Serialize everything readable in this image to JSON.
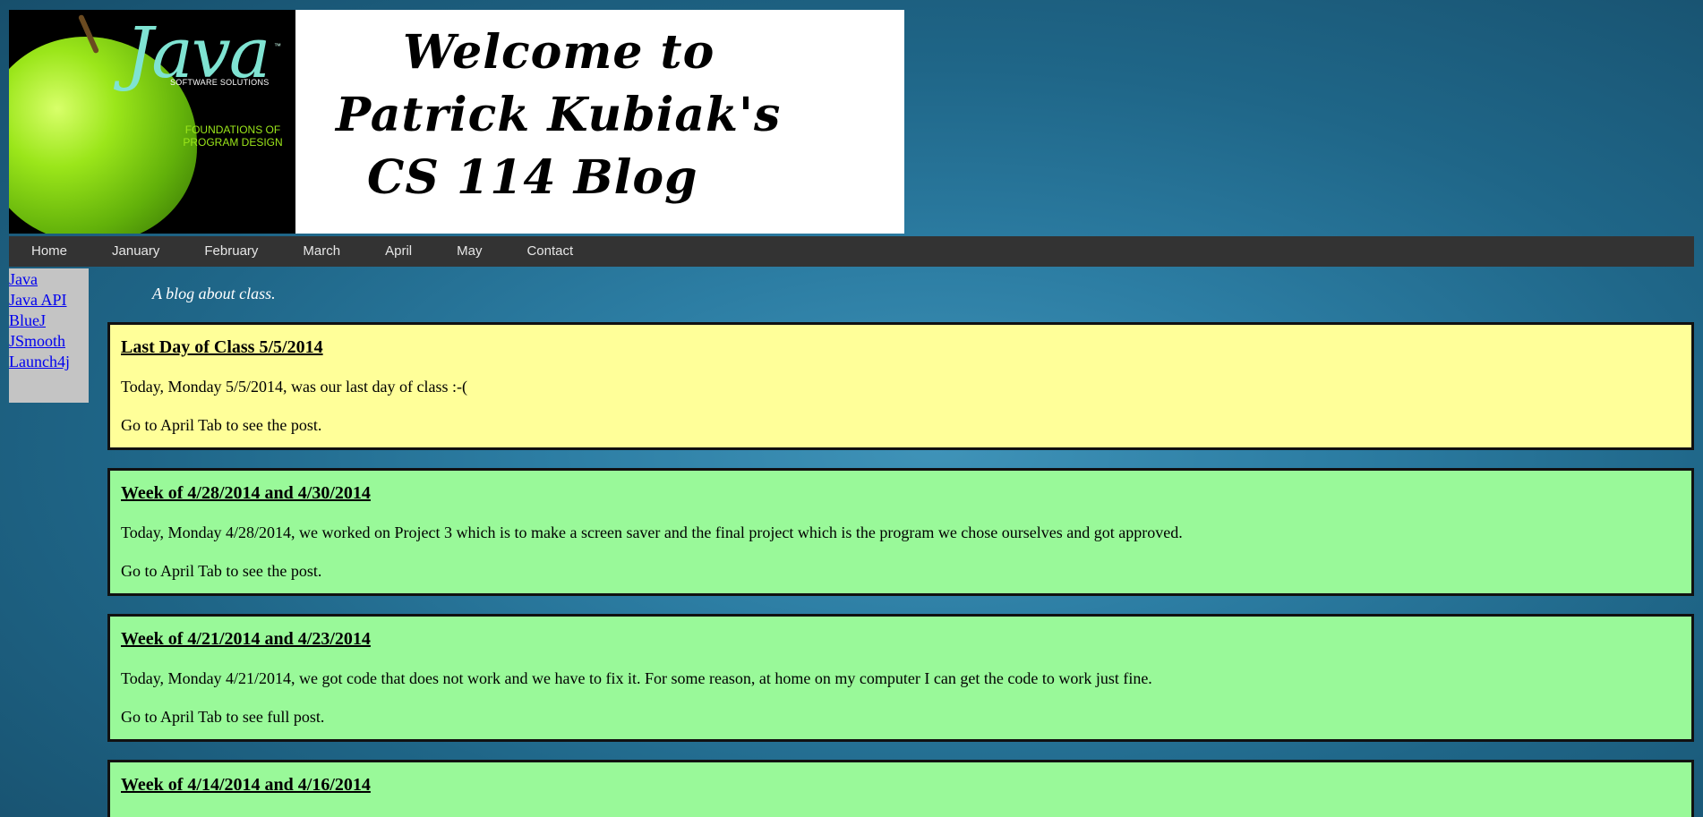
{
  "banner": {
    "logo_word": "Java",
    "logo_tm": "™",
    "logo_sub": "SOFTWARE SOLUTIONS",
    "logo_foundations": "FOUNDATIONS OF PROGRAM DESIGN",
    "line1": "Welcome to",
    "line2": "Patrick Kubiak's",
    "line3": "CS 114 Blog"
  },
  "nav": {
    "items": [
      "Home",
      "January",
      "February",
      "March",
      "April",
      "May",
      "Contact"
    ]
  },
  "sidebar": {
    "links": [
      "Java",
      "Java API",
      "BlueJ",
      "JSmooth",
      "Launch4j"
    ]
  },
  "tagline": "A blog about class.",
  "posts": [
    {
      "title": "Last Day of Class 5/5/2014",
      "p1": "Today, Monday 5/5/2014, was our last day of class :-(",
      "p2": "Go to April Tab to see the post.",
      "color": "#ffff99"
    },
    {
      "title": "Week of 4/28/2014 and 4/30/2014",
      "p1": "Today, Monday 4/28/2014, we worked on Project 3 which is to make a screen saver and the final project which is the program we chose ourselves and got approved.",
      "p2": "Go to April Tab to see the post.",
      "color": "#99f999"
    },
    {
      "title": "Week of 4/21/2014 and 4/23/2014",
      "p1": "Today, Monday 4/21/2014, we got code that does not work and we have to fix it. For some reason, at home on my computer I can get the code to work just fine.",
      "p2": "Go to April Tab to see full post.",
      "color": "#99f999"
    },
    {
      "title": "Week of 4/14/2014 and 4/16/2014",
      "color": "#99f999"
    }
  ]
}
